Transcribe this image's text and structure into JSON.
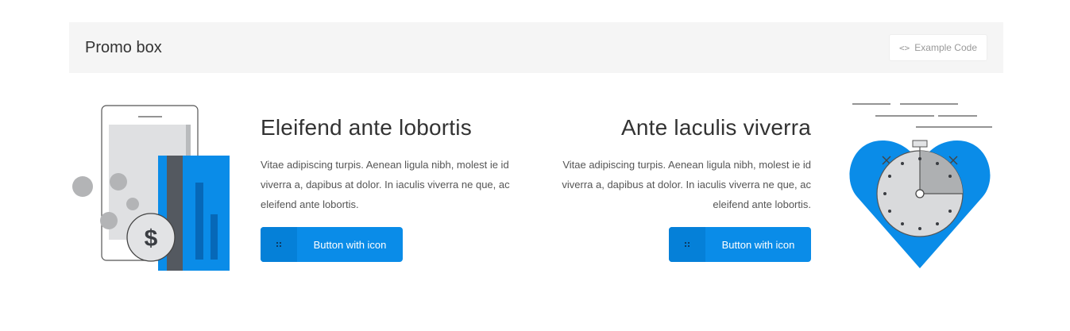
{
  "header": {
    "title": "Promo box",
    "code_button": {
      "label": "Example Code",
      "icon": "code-icon"
    }
  },
  "promos": [
    {
      "title": "Eleifend ante lobortis",
      "text": "Vitae adipiscing turpis. Aenean ligula nibh, molest ie id viverra a, dapibus at dolor. In iaculis viverra ne que, ac eleifend ante lobortis.",
      "button_label": "Button with icon",
      "illustration": "phone-card-money-icon"
    },
    {
      "title": "Ante laculis viverra",
      "text": "Vitae adipiscing turpis. Aenean ligula nibh, molest ie id viverra a, dapibus at dolor. In iaculis viverra ne que, ac eleifend ante lobortis.",
      "button_label": "Button with icon",
      "illustration": "heart-stopwatch-icon"
    }
  ],
  "colors": {
    "accent": "#0a8ce8",
    "accent_dark": "#0580d8",
    "header_bg": "#f5f5f5"
  }
}
